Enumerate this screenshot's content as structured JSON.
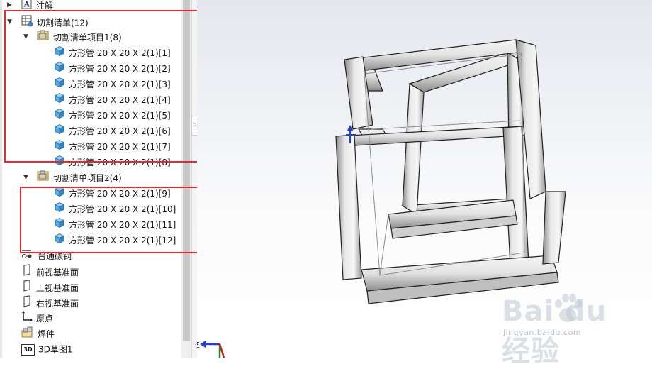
{
  "feature_tree": {
    "annotations_label": "注解",
    "cut_list": {
      "label": "切割清单(12)",
      "groups": [
        {
          "label": "切割清单项目1(8)",
          "items": [
            "方形管 20 X 20 X 2(1)[1]",
            "方形管 20 X 20 X 2(1)[2]",
            "方形管 20 X 20 X 2(1)[3]",
            "方形管 20 X 20 X 2(1)[4]",
            "方形管 20 X 20 X 2(1)[5]",
            "方形管 20 X 20 X 2(1)[6]",
            "方形管 20 X 20 X 2(1)[7]",
            "方形管 20 X 20 X 2(1)[8]"
          ]
        },
        {
          "label": "切割清单项目2(4)",
          "items": [
            "方形管 20 X 20 X 2(1)[9]",
            "方形管 20 X 20 X 2(1)[10]",
            "方形管 20 X 20 X 2(1)[11]",
            "方形管 20 X 20 X 2(1)[12]"
          ]
        }
      ]
    },
    "material_label": "普通碳钢",
    "front_plane": "前视基准面",
    "top_plane": "上视基准面",
    "right_plane": "右视基准面",
    "origin": "原点",
    "weldment": "焊件",
    "sketch3d": "3D草图1",
    "sketch3d_badge": "3D"
  },
  "viewport": {
    "triad_z_label": "Z"
  },
  "watermark": {
    "logo_text": "Bai du 经验",
    "url": "jingyan.baidu.com"
  },
  "colors": {
    "highlight_red": "#e8282c",
    "cube_blue": "#5aa9de",
    "frame_gray": "#e4e4e4"
  }
}
